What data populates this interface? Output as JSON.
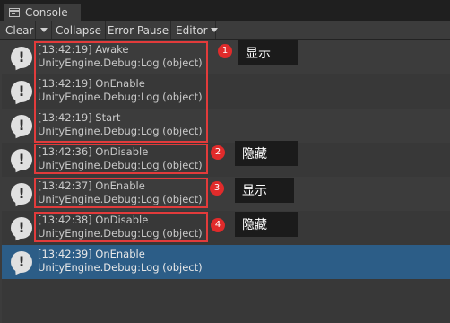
{
  "window": {
    "tab_title": "Console"
  },
  "toolbar": {
    "clear": "Clear",
    "collapse": "Collapse",
    "error_pause": "Error Pause",
    "editor": "Editor"
  },
  "logs": [
    {
      "line1": "[13:42:19] Awake",
      "line2": "UnityEngine.Debug:Log (object)"
    },
    {
      "line1": "[13:42:19] OnEnable",
      "line2": "UnityEngine.Debug:Log (object)"
    },
    {
      "line1": "[13:42:19] Start",
      "line2": "UnityEngine.Debug:Log (object)"
    },
    {
      "line1": "[13:42:36] OnDisable",
      "line2": "UnityEngine.Debug:Log (object)"
    },
    {
      "line1": "[13:42:37] OnEnable",
      "line2": "UnityEngine.Debug:Log (object)"
    },
    {
      "line1": "[13:42:38] OnDisable",
      "line2": "UnityEngine.Debug:Log (object)"
    },
    {
      "line1": "[13:42:39] OnEnable",
      "line2": "UnityEngine.Debug:Log (object)"
    }
  ],
  "icon_glyph": "!",
  "annotations": [
    {
      "number": "1",
      "text": "显示"
    },
    {
      "number": "2",
      "text": "隐藏"
    },
    {
      "number": "3",
      "text": "显示"
    },
    {
      "number": "4",
      "text": "隐藏"
    }
  ],
  "colors": {
    "annotation_red": "#e23b3b",
    "selection": "#2c5d87"
  }
}
